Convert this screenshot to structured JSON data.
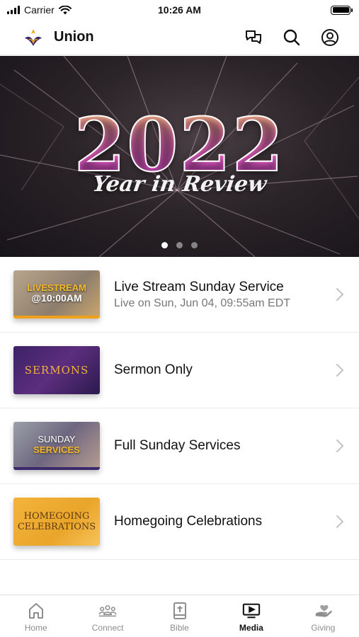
{
  "status_bar": {
    "carrier": "Carrier",
    "time": "10:26 AM"
  },
  "header": {
    "title": "Union"
  },
  "hero": {
    "year": "2022",
    "subtitle": "Year in Review",
    "slide_count": 3,
    "active_slide": 1
  },
  "media_items": [
    {
      "title": "Live Stream Sunday Service",
      "subtitle": "Live on Sun, Jun 04, 09:55am EDT",
      "thumb_line1": "LIVESTREAM",
      "thumb_line2": "@10:00AM"
    },
    {
      "title": "Sermon Only",
      "thumb_line1": "SERMONS"
    },
    {
      "title": "Full Sunday Services",
      "thumb_line1": "SUNDAY",
      "thumb_line2": "SERVICES"
    },
    {
      "title": "Homegoing Celebrations",
      "thumb_line1": "HOMEGOING",
      "thumb_line2": "CELEBRATIONS"
    }
  ],
  "tabs": [
    {
      "label": "Home",
      "icon": "home-icon"
    },
    {
      "label": "Connect",
      "icon": "people-icon"
    },
    {
      "label": "Bible",
      "icon": "bible-icon"
    },
    {
      "label": "Media",
      "icon": "tv-play-icon",
      "active": true
    },
    {
      "label": "Giving",
      "icon": "giving-hand-icon"
    }
  ],
  "colors": {
    "accent_gold": "#f0a019",
    "purple": "#3b2a6b",
    "text_primary": "#111111",
    "text_secondary": "#777777"
  }
}
